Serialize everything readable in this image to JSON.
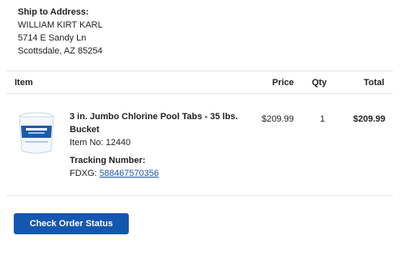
{
  "shipping": {
    "label": "Ship to Address:",
    "name": "WILLIAM KIRT KARL",
    "street": "5714 E Sandy Ln",
    "city_line": "Scottsdale, AZ 85254"
  },
  "table": {
    "headers": {
      "item": "Item",
      "price": "Price",
      "qty": "Qty",
      "total": "Total"
    },
    "row": {
      "image_icon": "pool-tabs-bucket-image",
      "name": "3 in. Jumbo Chlorine Pool Tabs - 35 lbs. Bucket",
      "item_no": "Item No: 12440",
      "tracking_label": "Tracking Number:",
      "tracking_prefix": "FDXG:",
      "tracking_number": "588467570356",
      "price": "$209.99",
      "qty": "1",
      "total": "$209.99"
    }
  },
  "actions": {
    "check_status_label": "Check Order Status"
  },
  "colors": {
    "accent": "#1457b0",
    "link": "#1b57a7",
    "divider": "#e6e6e6"
  }
}
